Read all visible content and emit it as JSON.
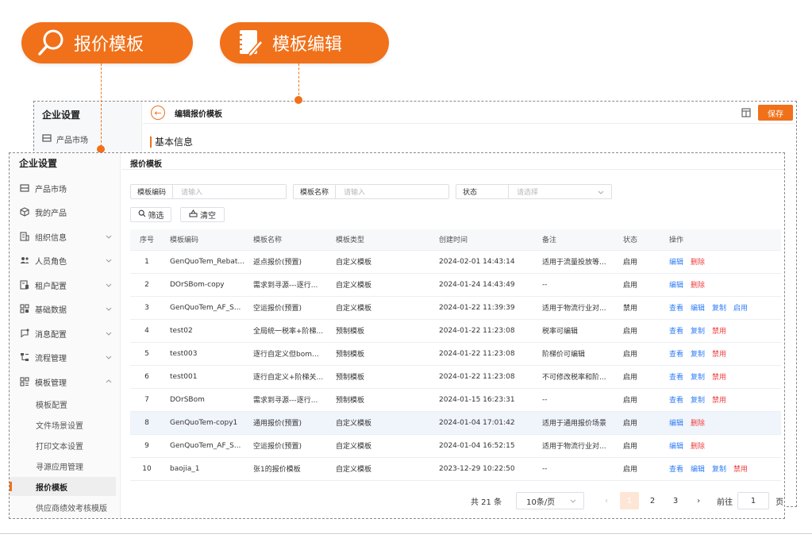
{
  "callouts": {
    "badge1": {
      "icon": "search-icon",
      "label": "报价模板"
    },
    "badge2": {
      "icon": "notebook-edit-icon",
      "label": "模板编辑"
    },
    "color": "#f0711a"
  },
  "background_window": {
    "sidebar_title": "企业设置",
    "sidebar_first_item": "产品市场",
    "page_title": "编辑报价模板",
    "save_label": "保存",
    "section_title": "基本信息"
  },
  "sidebar": {
    "title": "企业设置",
    "items": [
      {
        "icon": "box-icon",
        "label": "产品市场",
        "expandable": false
      },
      {
        "icon": "cube-icon",
        "label": "我的产品",
        "expandable": false
      },
      {
        "icon": "org-icon",
        "label": "组织信息",
        "expandable": true
      },
      {
        "icon": "users-icon",
        "label": "人员角色",
        "expandable": true
      },
      {
        "icon": "tenant-icon",
        "label": "租户配置",
        "expandable": true
      },
      {
        "icon": "data-icon",
        "label": "基础数据",
        "expandable": true
      },
      {
        "icon": "message-icon",
        "label": "消息配置",
        "expandable": true
      },
      {
        "icon": "flow-icon",
        "label": "流程管理",
        "expandable": true
      },
      {
        "icon": "template-icon",
        "label": "模板管理",
        "expandable": true,
        "expanded": true
      }
    ],
    "subitems": [
      {
        "label": "模板配置",
        "active": false
      },
      {
        "label": "文件场景设置",
        "active": false
      },
      {
        "label": "打印文本设置",
        "active": false
      },
      {
        "label": "寻源应用管理",
        "active": false
      },
      {
        "label": "报价模板",
        "active": true
      },
      {
        "label": "供应商绩效考核模版",
        "active": false
      }
    ]
  },
  "content": {
    "title": "报价模板",
    "filters": [
      {
        "label": "模板编码",
        "placeholder": "请输入"
      },
      {
        "label": "模板名称",
        "placeholder": "请输入"
      },
      {
        "label": "状态",
        "placeholder": "请选择"
      }
    ],
    "filter_button": "筛选",
    "clear_button": "清空",
    "table": {
      "columns": [
        "序号",
        "模板编码",
        "模板名称",
        "模板类型",
        "创建时间",
        "备注",
        "状态",
        "操作"
      ],
      "rows": [
        {
          "no": "1",
          "code": "GenQuoTem_Rebat...",
          "name": "返点报价(预置)",
          "type": "自定义模板",
          "created": "2024-02-01 14:43:14",
          "remark": "适用于流量投放等...",
          "status": "启用",
          "actions": [
            {
              "label": "编辑",
              "color": "blue"
            },
            {
              "label": "删除",
              "color": "red"
            }
          ]
        },
        {
          "no": "2",
          "code": "DOrSBom-copy",
          "name": "需求到寻源---逐行...",
          "type": "自定义模板",
          "created": "2024-01-24 14:43:49",
          "remark": "--",
          "status": "启用",
          "actions": [
            {
              "label": "编辑",
              "color": "blue"
            },
            {
              "label": "删除",
              "color": "red"
            }
          ]
        },
        {
          "no": "3",
          "code": "GenQuoTem_AF_S...",
          "name": "空运报价(预置)",
          "type": "自定义模板",
          "created": "2024-01-22 11:39:39",
          "remark": "适用于物流行业对...",
          "status": "禁用",
          "actions": [
            {
              "label": "查看",
              "color": "blue"
            },
            {
              "label": "编辑",
              "color": "blue"
            },
            {
              "label": "复制",
              "color": "blue"
            },
            {
              "label": "启用",
              "color": "blue"
            }
          ]
        },
        {
          "no": "4",
          "code": "test02",
          "name": "全局统一税率+阶梯...",
          "type": "预制模板",
          "created": "2024-01-22 11:23:08",
          "remark": "税率可编辑",
          "status": "启用",
          "actions": [
            {
              "label": "查看",
              "color": "blue"
            },
            {
              "label": "复制",
              "color": "blue"
            },
            {
              "label": "禁用",
              "color": "red"
            }
          ]
        },
        {
          "no": "5",
          "code": "test003",
          "name": "逐行自定义但bom...",
          "type": "预制模板",
          "created": "2024-01-22 11:23:08",
          "remark": "阶梯价可编辑",
          "status": "启用",
          "actions": [
            {
              "label": "查看",
              "color": "blue"
            },
            {
              "label": "复制",
              "color": "blue"
            },
            {
              "label": "禁用",
              "color": "red"
            }
          ]
        },
        {
          "no": "6",
          "code": "test001",
          "name": "逐行自定义+阶梯关...",
          "type": "预制模板",
          "created": "2024-01-22 11:23:08",
          "remark": "不可修改税率和阶...",
          "status": "启用",
          "actions": [
            {
              "label": "查看",
              "color": "blue"
            },
            {
              "label": "复制",
              "color": "blue"
            },
            {
              "label": "禁用",
              "color": "red"
            }
          ]
        },
        {
          "no": "7",
          "code": "DOrSBom",
          "name": "需求到寻源---逐行...",
          "type": "预制模板",
          "created": "2024-01-15 16:23:31",
          "remark": "--",
          "status": "启用",
          "actions": [
            {
              "label": "查看",
              "color": "blue"
            },
            {
              "label": "复制",
              "color": "blue"
            },
            {
              "label": "禁用",
              "color": "red"
            }
          ]
        },
        {
          "no": "8",
          "code": "GenQuoTem-copy1",
          "name": "通用报价(预置)",
          "type": "自定义模板",
          "created": "2024-01-04 17:01:42",
          "remark": "适用于通用报价场景",
          "status": "启用",
          "highlight": true,
          "actions": [
            {
              "label": "编辑",
              "color": "blue"
            },
            {
              "label": "删除",
              "color": "red"
            }
          ]
        },
        {
          "no": "9",
          "code": "GenQuoTem_AF_S...",
          "name": "空运报价(预置)",
          "type": "自定义模板",
          "created": "2024-01-04 16:52:15",
          "remark": "适用于物流行业对...",
          "status": "启用",
          "actions": [
            {
              "label": "编辑",
              "color": "blue"
            },
            {
              "label": "删除",
              "color": "red"
            }
          ]
        },
        {
          "no": "10",
          "code": "baojia_1",
          "name": "张1的报价模板",
          "type": "自定义模板",
          "created": "2023-12-29 10:22:50",
          "remark": "--",
          "status": "启用",
          "actions": [
            {
              "label": "查看",
              "color": "blue"
            },
            {
              "label": "编辑",
              "color": "blue"
            },
            {
              "label": "复制",
              "color": "blue"
            },
            {
              "label": "禁用",
              "color": "red"
            }
          ]
        }
      ]
    },
    "pagination": {
      "total": "共 21 条",
      "page_size": "10条/页",
      "prev": "‹",
      "pages": [
        "1",
        "2",
        "3"
      ],
      "current": "1",
      "next": "›",
      "goto_label": "前往",
      "goto_value": "1",
      "page_unit": "页"
    }
  }
}
